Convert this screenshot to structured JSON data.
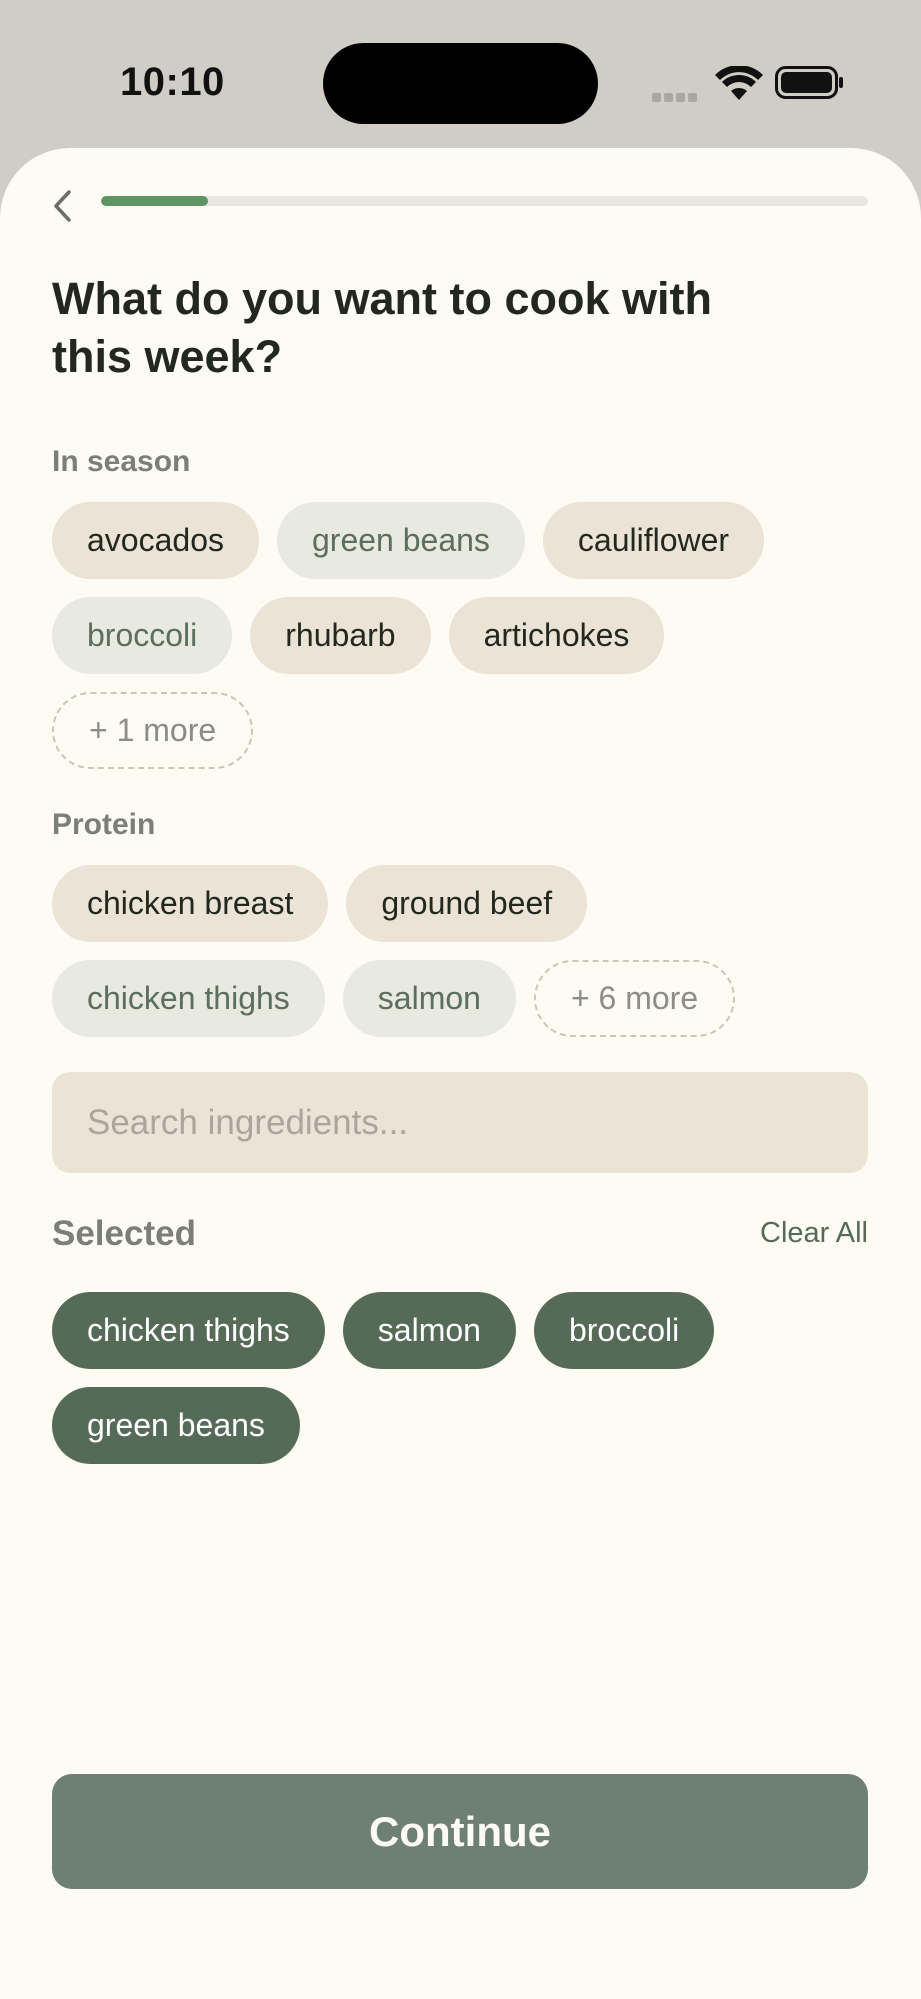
{
  "status_bar": {
    "time": "10:10"
  },
  "header": {
    "back_icon": "chevron-left-icon",
    "progress": 0.14
  },
  "title": "What do you want to cook with this week?",
  "sections": {
    "in_season": {
      "label": "In season",
      "chips": [
        "avocados",
        "green beans",
        "cauliflower",
        "broccoli",
        "rhubarb",
        "artichokes"
      ],
      "more": "+ 1 more"
    },
    "protein": {
      "label": "Protein",
      "chips": [
        "chicken breast",
        "ground beef",
        "chicken thighs",
        "salmon"
      ],
      "more": "+ 6 more"
    }
  },
  "search": {
    "placeholder": "Search ingredients...",
    "value": ""
  },
  "selected": {
    "label": "Selected",
    "clear_label": "Clear All",
    "items": [
      "chicken thighs",
      "salmon",
      "broccoli",
      "green beans"
    ]
  },
  "continue_label": "Continue",
  "colors": {
    "background": "#fdfbf4",
    "accent": "#5f9563",
    "selected_chip": "#556b58",
    "button": "#6e8071",
    "chip_tan": "#ebe3d6",
    "chip_grey": "#e8e9e1"
  }
}
